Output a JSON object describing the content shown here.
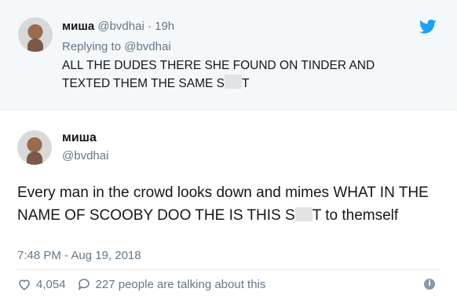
{
  "parent_tweet": {
    "display_name": "миша",
    "handle": "@bvdhai",
    "separator": "·",
    "time": "19h",
    "replying_prefix": "Replying to",
    "replying_handle": "@bvdhai",
    "text_line1": "ALL THE DUDES THERE SHE FOUND ON TINDER AND",
    "text_line2_a": "TEXTED THEM THE SAME S",
    "text_line2_b": "T"
  },
  "main_tweet": {
    "display_name": "миша",
    "handle": "@bvdhai",
    "text_a": "Every man in the crowd looks down and mimes WHAT IN THE NAME OF SCOOBY DOO THE IS THIS S",
    "text_b": "T to themself",
    "timestamp": "7:48 PM - Aug 19, 2018",
    "like_count": "4,054",
    "talking_text": "227 people are talking about this"
  },
  "icons": {
    "brand": "twitter-bird-icon",
    "like": "heart-icon",
    "reply": "speech-bubble-icon",
    "info": "info-icon"
  },
  "colors": {
    "twitter_blue": "#1da1f2",
    "muted": "#657786",
    "parent_bg": "#f5f8fa"
  }
}
